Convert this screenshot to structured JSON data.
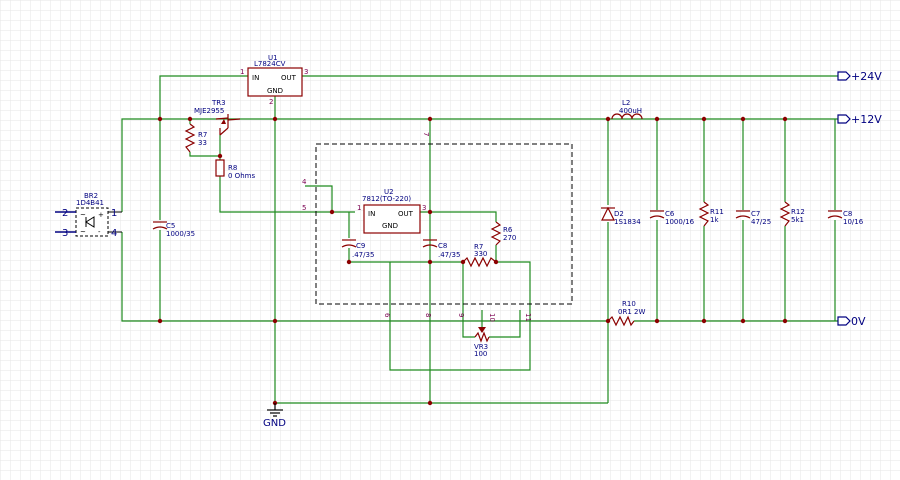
{
  "nets": {
    "v24": "+24V",
    "v12": "+12V",
    "v0": "0V",
    "gnd": "GND"
  },
  "components": {
    "u1": {
      "ref": "U1",
      "value": "L7824CV",
      "pin_in": "IN",
      "pin_out": "OUT",
      "pin_gnd": "GND",
      "n1": "1",
      "n2": "2",
      "n3": "3"
    },
    "u2": {
      "ref": "U2",
      "value": "7812(TO-220)",
      "pin_in": "IN",
      "pin_out": "OUT",
      "pin_gnd": "GND",
      "n1": "1",
      "n2": "2",
      "n3": "3"
    },
    "tr3": {
      "ref": "TR3",
      "value": "MJE2955"
    },
    "br2": {
      "ref": "BR2",
      "value": "1D4B41",
      "n1": "1",
      "n2": "2",
      "n3": "3",
      "n4": "4"
    },
    "r7a": {
      "ref": "R7",
      "value": "33"
    },
    "r8": {
      "ref": "R8",
      "value": "0 Ohms"
    },
    "c5": {
      "ref": "C5",
      "value": "1000/35"
    },
    "c9": {
      "ref": "C9",
      "value": ".47/35"
    },
    "c8a": {
      "ref": "C8",
      "value": ".47/35"
    },
    "r7b": {
      "ref": "R7",
      "value": "330"
    },
    "r6": {
      "ref": "R6",
      "value": "270"
    },
    "vr3": {
      "ref": "VR3",
      "value": "100"
    },
    "l2": {
      "ref": "L2",
      "value": "400uH"
    },
    "d2": {
      "ref": "D2",
      "value": "1S1834"
    },
    "c6": {
      "ref": "C6",
      "value": "1000/16"
    },
    "r11": {
      "ref": "R11",
      "value": "1k"
    },
    "c7": {
      "ref": "C7",
      "value": "47/25"
    },
    "r12": {
      "ref": "R12",
      "value": "5k1"
    },
    "c8b": {
      "ref": "C8",
      "value": "10/16"
    },
    "r10": {
      "ref": "R10",
      "value": "0R1 2W"
    }
  },
  "sheet_pins": {
    "p4": "4",
    "p5": "5",
    "p6": "6",
    "p7": "7",
    "p8": "8",
    "p9": "9",
    "p10": "10",
    "p11": "11"
  }
}
